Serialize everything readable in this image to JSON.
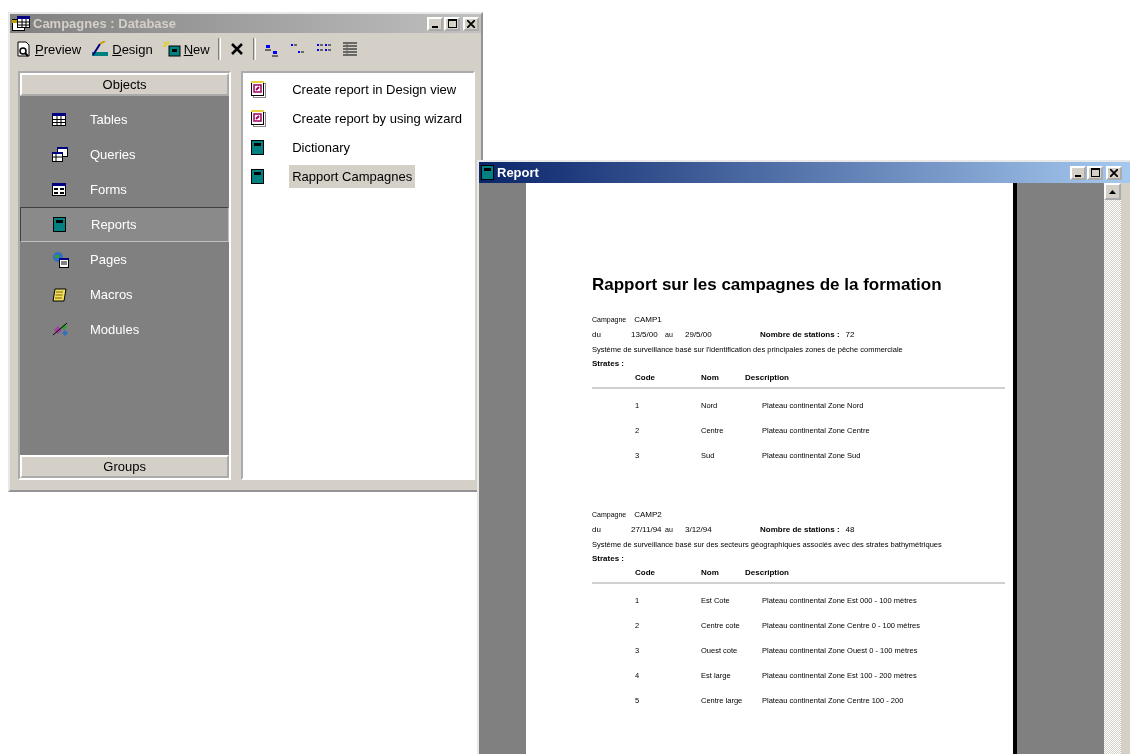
{
  "database_window": {
    "title": "Campagnes : Database",
    "toolbar": [
      {
        "kind": "preview",
        "label": "Preview"
      },
      {
        "kind": "design",
        "label": "Design"
      },
      {
        "kind": "new",
        "label": "New"
      },
      {
        "kind": "delete"
      },
      {
        "kind": "large-icons"
      },
      {
        "kind": "small-icons"
      },
      {
        "kind": "list"
      },
      {
        "kind": "details"
      }
    ],
    "objects_header": "Objects",
    "objects": [
      {
        "kind": "table",
        "label": "Tables",
        "selected": false
      },
      {
        "kind": "query",
        "label": "Queries",
        "selected": false
      },
      {
        "kind": "form",
        "label": "Forms",
        "selected": false
      },
      {
        "kind": "report",
        "label": "Reports",
        "selected": true
      },
      {
        "kind": "page",
        "label": "Pages",
        "selected": false
      },
      {
        "kind": "macro",
        "label": "Macros",
        "selected": false
      },
      {
        "kind": "module",
        "label": "Modules",
        "selected": false
      }
    ],
    "groups_header": "Groups",
    "items": [
      {
        "kind": "wizard",
        "label": "Create report in Design view",
        "selected": false
      },
      {
        "kind": "wizard",
        "label": "Create report by using wizard",
        "selected": false
      },
      {
        "kind": "report",
        "label": "Dictionary",
        "selected": false
      },
      {
        "kind": "report",
        "label": "Rapport Campagnes",
        "selected": true
      }
    ]
  },
  "report_window": {
    "title": "Report",
    "report": {
      "title": "Rapport sur les campagnes de la formation",
      "campaigns": [
        {
          "campaign_label": "Campagne",
          "campaign": "CAMP1",
          "from_label": "du",
          "from": "13/5/00",
          "to_label": "au",
          "to": "29/5/00",
          "stations_label": "Nombre de stations :",
          "stations": "72",
          "description": "Système de surveillance basé sur l'identification des principales zones de pêche commerciale",
          "strata_label": "Strates :",
          "columns": [
            "Code",
            "Nom",
            "Description"
          ],
          "rows": [
            [
              "1",
              "Nord",
              "Plateau continental Zone Nord"
            ],
            [
              "2",
              "Centre",
              "Plateau continental Zone Centre"
            ],
            [
              "3",
              "Sud",
              "Plateau continental Zone Sud"
            ]
          ]
        },
        {
          "campaign_label": "Campagne",
          "campaign": "CAMP2",
          "from_label": "du",
          "from": "27/11/94",
          "to_label": "au",
          "to": "3/12/94",
          "stations_label": "Nombre de stations :",
          "stations": "48",
          "description": "Système de surveillance basé sur des secteurs géographiques associés avec des strates bathymétriques",
          "strata_label": "Strates :",
          "columns": [
            "Code",
            "Nom",
            "Description"
          ],
          "rows": [
            [
              "1",
              "Est Cote",
              "Plateau continental Zone Est 000 - 100 mètres"
            ],
            [
              "2",
              "Centre cote",
              "Plateau continental Zone Centre 0 - 100 mètres"
            ],
            [
              "3",
              "Ouest cote",
              "Plateau continental Zone Ouest 0 - 100 mètres"
            ],
            [
              "4",
              "Est large",
              "Plateau continental Zone Est 100 - 200 mètres"
            ],
            [
              "5",
              "Centre large",
              "Plateau continental Zone Centre 100 - 200"
            ]
          ]
        }
      ]
    }
  }
}
